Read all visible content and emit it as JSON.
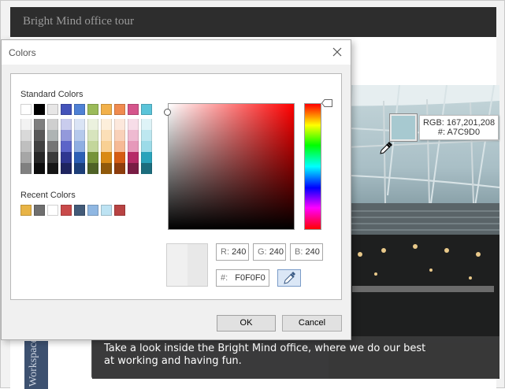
{
  "background": {
    "page_title": "Bright Mind office tour",
    "caption": "Take a look inside the Bright Mind office, where we do our best at working and having fun.",
    "side_tab": "Workspace"
  },
  "picker_tooltip": {
    "rgb": "RGB: 167,201,208",
    "hex": "#: A7C9D0",
    "color": "#A7C9D0"
  },
  "dialog": {
    "title": "Colors",
    "standard_label": "Standard Colors",
    "recent_label": "Recent Colors",
    "standard_top_row": [
      "#ffffff",
      "#000000",
      "#e7e6e6",
      "#4453ba",
      "#4f81d5",
      "#9bbb59",
      "#f2b14a",
      "#f08b4f",
      "#d5558c",
      "#5bc4d9"
    ],
    "standard_shades": [
      [
        "#f2f2f2",
        "#d9d9d9",
        "#bfbfbf",
        "#a6a6a6",
        "#808080"
      ],
      [
        "#7f7f7f",
        "#595959",
        "#404040",
        "#262626",
        "#0d0d0d"
      ],
      [
        "#cfcfcf",
        "#aeb4b4",
        "#757575",
        "#3a3a3a",
        "#161616"
      ],
      [
        "#c9cced",
        "#9399db",
        "#5c64c8",
        "#2f3690",
        "#1f245f"
      ],
      [
        "#dae4f5",
        "#b5c9ec",
        "#8faee2",
        "#2d5fb5",
        "#1d3f79"
      ],
      [
        "#ebf1de",
        "#d7e4bd",
        "#c3d69b",
        "#769339",
        "#4f6226"
      ],
      [
        "#fdefdb",
        "#fbdfb7",
        "#f8d093",
        "#d98a14",
        "#90590b"
      ],
      [
        "#fce8dc",
        "#f9d1b9",
        "#f6ba96",
        "#d55c13",
        "#8e3d0c"
      ],
      [
        "#f7dde8",
        "#eebad1",
        "#e699ba",
        "#b62a67",
        "#791c44"
      ],
      [
        "#def3f7",
        "#bde7f0",
        "#9cdbe8",
        "#2aa3bb",
        "#1c6d7d"
      ]
    ],
    "recent_colors": [
      "#e8b446",
      "#6f6f6f",
      "#ffffff",
      "#c94a4a",
      "#425a78",
      "#8fb7e2",
      "#bde3f3",
      "#b84343"
    ],
    "rgb": {
      "r_label": "R:",
      "r": "240",
      "g_label": "G:",
      "g": "240",
      "b_label": "B:",
      "b": "240"
    },
    "hex_label": "#:",
    "hex": "F0F0F0",
    "ok_label": "OK",
    "cancel_label": "Cancel"
  }
}
